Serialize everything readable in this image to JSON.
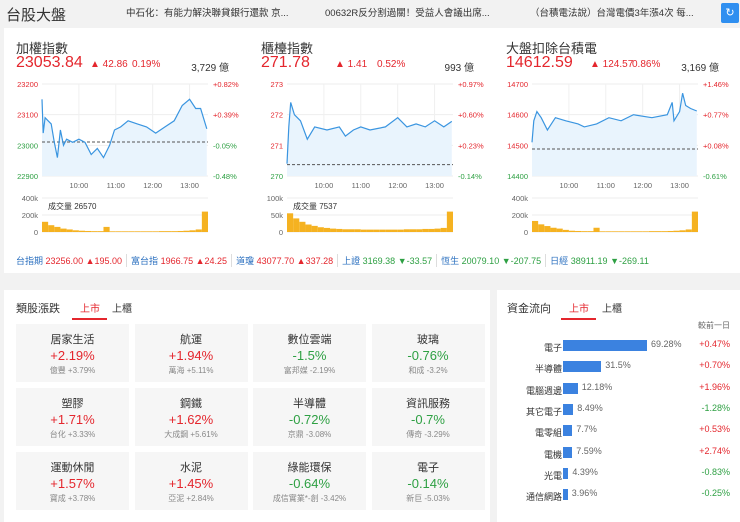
{
  "header": {
    "title": "台股大盤",
    "news": [
      "中石化：有能力解決聯貸銀行還款 京...",
      "00632R反分割過關！受益人會議出席...",
      "（台積電法說）台灣電價3年漲4次 每..."
    ],
    "refresh_icon": "refresh-icon"
  },
  "indices": [
    {
      "name": "加權指數",
      "price": "23053.84",
      "change": "▲ 42.86",
      "pct": "0.19%",
      "amount": "3,729 億",
      "y_labels": [
        "23200",
        "23100",
        "23000",
        "22900"
      ],
      "pct_labels": [
        "+0.82%",
        "+0.39%",
        "-0.05%",
        "-0.48%"
      ],
      "y_colors": [
        "#e4262d",
        "#e4262d",
        "#2ea043",
        "#2ea043"
      ],
      "pct_colors": [
        "#e4262d",
        "#e4262d",
        "#2ea043",
        "#2ea043"
      ],
      "vol_labels": [
        "400k",
        "200k",
        "0"
      ],
      "vol_text": "成交量 26570"
    },
    {
      "name": "櫃檯指數",
      "price": "271.78",
      "change": "▲ 1.41",
      "pct": "0.52%",
      "amount": "993 億",
      "y_labels": [
        "273",
        "272",
        "271",
        "270"
      ],
      "pct_labels": [
        "+0.97%",
        "+0.60%",
        "+0.23%",
        "-0.14%"
      ],
      "y_colors": [
        "#e4262d",
        "#e4262d",
        "#e4262d",
        "#2ea043"
      ],
      "pct_colors": [
        "#e4262d",
        "#e4262d",
        "#e4262d",
        "#2ea043"
      ],
      "vol_labels": [
        "100k",
        "50k",
        "0"
      ],
      "vol_text": "成交量 7537"
    },
    {
      "name": "大盤扣除台積電",
      "price": "14612.59",
      "change": "▲ 124.57",
      "pct": "0.86%",
      "amount": "3,169 億",
      "y_labels": [
        "14700",
        "14600",
        "14500",
        "14400"
      ],
      "pct_labels": [
        "+1.46%",
        "+0.77%",
        "+0.08%",
        "-0.61%"
      ],
      "y_colors": [
        "#e4262d",
        "#e4262d",
        "#e4262d",
        "#2ea043"
      ],
      "pct_colors": [
        "#e4262d",
        "#e4262d",
        "#e4262d",
        "#2ea043"
      ],
      "vol_labels": [
        "400k",
        "200k",
        "0"
      ],
      "vol_text": ""
    }
  ],
  "time_labels": [
    "10:00",
    "11:00",
    "12:00",
    "13:00"
  ],
  "chart_data": [
    {
      "type": "line",
      "title": "加權指數",
      "ylim": [
        22900,
        23200
      ],
      "prev_close": 23011,
      "x_minutes": [
        0,
        2,
        5,
        10,
        15,
        20,
        25,
        30,
        35,
        40,
        50,
        60,
        70,
        80,
        90,
        100,
        110,
        118,
        128,
        140,
        155,
        170,
        185,
        200,
        215,
        228,
        240,
        250,
        258,
        268
      ],
      "values": [
        23150,
        23040,
        23090,
        23080,
        23070,
        23010,
        22960,
        23050,
        23000,
        23020,
        23010,
        23020,
        23010,
        22970,
        22990,
        22960,
        23000,
        23050,
        23060,
        23080,
        23070,
        23060,
        23040,
        23060,
        23080,
        23130,
        23150,
        23120,
        23120,
        23054
      ],
      "volume_ylim": [
        0,
        400000
      ],
      "volume": [
        120,
        80,
        60,
        40,
        30,
        20,
        15,
        12,
        10,
        10,
        60,
        8,
        8,
        8,
        8,
        8,
        8,
        8,
        8,
        10,
        10,
        10,
        12,
        15,
        20,
        30,
        240
      ]
    },
    {
      "type": "line",
      "title": "櫃檯指數",
      "ylim": [
        270,
        273
      ],
      "prev_close": 270.37,
      "x_minutes": [
        0,
        3,
        6,
        12,
        22,
        33,
        45,
        65,
        85,
        95,
        108,
        120,
        135,
        160,
        180,
        195,
        210,
        225,
        240,
        255,
        268
      ],
      "values": [
        270.4,
        271.6,
        272.4,
        272.0,
        271.8,
        271.2,
        271.6,
        271.5,
        271.6,
        271.3,
        271.5,
        271.6,
        271.5,
        271.6,
        271.9,
        271.6,
        271.7,
        271.6,
        271.8,
        271.6,
        271.78
      ],
      "volume_ylim": [
        0,
        100000
      ],
      "volume": [
        55,
        40,
        30,
        22,
        18,
        14,
        12,
        10,
        9,
        8,
        8,
        8,
        7,
        7,
        7,
        7,
        7,
        7,
        7,
        8,
        8,
        8,
        9,
        9,
        10,
        12,
        60
      ]
    },
    {
      "type": "line",
      "title": "大盤扣除台積電",
      "ylim": [
        14400,
        14700
      ],
      "prev_close": 14487.9,
      "x_minutes": [
        0,
        3,
        8,
        15,
        25,
        38,
        55,
        75,
        85,
        105,
        125,
        145,
        165,
        195,
        220,
        228,
        231,
        240,
        245,
        250,
        258,
        268
      ],
      "values": [
        14510,
        14580,
        14610,
        14590,
        14550,
        14590,
        14580,
        14570,
        14560,
        14570,
        14590,
        14580,
        14600,
        14590,
        14600,
        14640,
        14580,
        14610,
        14670,
        14630,
        14620,
        14612
      ],
      "volume_ylim": [
        0,
        400000
      ],
      "volume": [
        130,
        90,
        70,
        50,
        40,
        25,
        15,
        12,
        10,
        10,
        50,
        8,
        8,
        8,
        8,
        8,
        8,
        8,
        8,
        10,
        10,
        10,
        12,
        15,
        20,
        30,
        240
      ]
    }
  ],
  "ticker": [
    {
      "name": "台指期",
      "value": "23256.00",
      "change": "▲195.00",
      "dir": "up"
    },
    {
      "name": "富台指",
      "value": "1966.75",
      "change": "▲24.25",
      "dir": "up"
    },
    {
      "name": "道瓊",
      "value": "43077.70",
      "change": "▲337.28",
      "dir": "up"
    },
    {
      "name": "上證",
      "value": "3169.38",
      "change": "▼-33.57",
      "dir": "dn"
    },
    {
      "name": "恆生",
      "value": "20079.10",
      "change": "▼-207.75",
      "dir": "dn"
    },
    {
      "name": "日經",
      "value": "38911.19",
      "change": "▼-269.11",
      "dir": "dn"
    }
  ],
  "sectors": {
    "title": "類股漲跌",
    "tabs": [
      "上市",
      "上櫃"
    ],
    "items": [
      {
        "name": "居家生活",
        "pct": "+2.19%",
        "dir": "up",
        "lead": "億豐  +3.79%"
      },
      {
        "name": "航運",
        "pct": "+1.94%",
        "dir": "up",
        "lead": "萬海  +5.11%"
      },
      {
        "name": "數位雲端",
        "pct": "-1.5%",
        "dir": "dn",
        "lead": "富邦媒  -2.19%"
      },
      {
        "name": "玻璃",
        "pct": "-0.76%",
        "dir": "dn",
        "lead": "和成  -3.2%"
      },
      {
        "name": "塑膠",
        "pct": "+1.71%",
        "dir": "up",
        "lead": "台化  +3.33%"
      },
      {
        "name": "鋼鐵",
        "pct": "+1.62%",
        "dir": "up",
        "lead": "大成鋼  +5.61%"
      },
      {
        "name": "半導體",
        "pct": "-0.72%",
        "dir": "dn",
        "lead": "京鼎  -3.08%"
      },
      {
        "name": "資訊服務",
        "pct": "-0.7%",
        "dir": "dn",
        "lead": "傳奇  -3.29%"
      },
      {
        "name": "運動休閒",
        "pct": "+1.57%",
        "dir": "up",
        "lead": "寶成  +3.78%"
      },
      {
        "name": "水泥",
        "pct": "+1.45%",
        "dir": "up",
        "lead": "亞泥  +2.84%"
      },
      {
        "name": "綠能環保",
        "pct": "-0.64%",
        "dir": "dn",
        "lead": "成信實業*-創  -3.42%"
      },
      {
        "name": "電子",
        "pct": "-0.14%",
        "dir": "dn",
        "lead": "新巨  -5.03%"
      }
    ]
  },
  "fund_flow": {
    "title": "資金流向",
    "tabs": [
      "上市",
      "上櫃"
    ],
    "col_header": "較前一日",
    "items": [
      {
        "name": "電子",
        "share": 69.28,
        "share_text": "69.28%",
        "change": "+0.47%",
        "dir": "up"
      },
      {
        "name": "半導體",
        "share": 31.5,
        "share_text": "31.5%",
        "change": "+0.70%",
        "dir": "up"
      },
      {
        "name": "電腦週邊",
        "share": 12.18,
        "share_text": "12.18%",
        "change": "+1.96%",
        "dir": "up"
      },
      {
        "name": "其它電子",
        "share": 8.49,
        "share_text": "8.49%",
        "change": "-1.28%",
        "dir": "dn"
      },
      {
        "name": "電零組",
        "share": 7.7,
        "share_text": "7.7%",
        "change": "+0.53%",
        "dir": "up"
      },
      {
        "name": "電機",
        "share": 7.59,
        "share_text": "7.59%",
        "change": "+2.74%",
        "dir": "up"
      },
      {
        "name": "光電",
        "share": 4.39,
        "share_text": "4.39%",
        "change": "-0.83%",
        "dir": "dn"
      },
      {
        "name": "通信網路",
        "share": 3.96,
        "share_text": "3.96%",
        "change": "-0.25%",
        "dir": "dn"
      }
    ]
  }
}
